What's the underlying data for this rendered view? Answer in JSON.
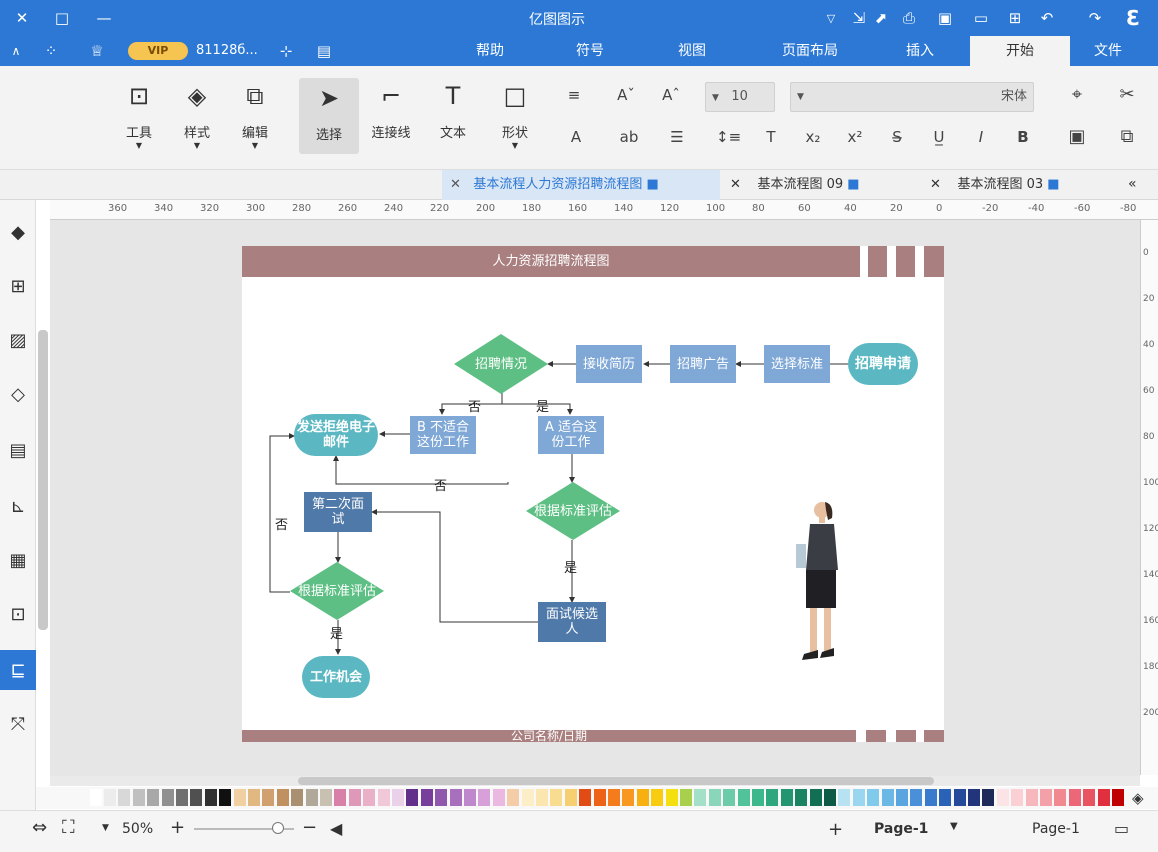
{
  "window": {
    "title": "亿图图示",
    "controls": {
      "close": "✕",
      "maximize": "□",
      "minimize": "—"
    },
    "account_id": "81128б...",
    "vip": "VIP"
  },
  "menu": {
    "tabs": [
      "文件",
      "开始",
      "插入",
      "页面布局",
      "视图",
      "符号",
      "帮助"
    ],
    "active_tab": "开始"
  },
  "ribbon": {
    "tools": [
      {
        "label": "工具",
        "icon": "tools-icon"
      },
      {
        "label": "样式",
        "icon": "paint-bucket-icon"
      },
      {
        "label": "编辑",
        "icon": "edit-frame-icon"
      },
      {
        "label": "选择",
        "icon": "select-arrow-icon"
      },
      {
        "label": "连接线",
        "icon": "connector-icon"
      },
      {
        "label": "文本",
        "icon": "text-icon"
      },
      {
        "label": "形状",
        "icon": "shape-icon"
      }
    ],
    "font_name": "宋体",
    "font_size": "10"
  },
  "doc_tabs": [
    {
      "title": "基本流程图 03"
    },
    {
      "title": "基本流程图 09"
    },
    {
      "title": "基本流程人力资源招聘流程图"
    }
  ],
  "ruler": {
    "h_labels": [
      "-80",
      "-60",
      "-40",
      "-20",
      "0",
      "20",
      "40",
      "60",
      "80",
      "100",
      "120",
      "140",
      "160",
      "180",
      "200",
      "220",
      "240",
      "260",
      "280",
      "300",
      "320",
      "340",
      "360"
    ],
    "v_labels": [
      "0",
      "20",
      "40",
      "60",
      "80",
      "100",
      "120",
      "140",
      "160",
      "180",
      "200"
    ]
  },
  "diagram": {
    "title": "人力资源招聘流程图",
    "footer": "公司名称/日期",
    "nodes": {
      "apply": "招聘申请",
      "criteria": "选择标准",
      "ad": "招聘广告",
      "resume": "接收简历",
      "status": "招聘情况",
      "fitA": "A 适合这份工作",
      "notfitB": "B 不适合这份工作",
      "reject": "发送拒绝电子邮件",
      "eval1": "根据标准评估",
      "interview2": "第二次面试",
      "candidate": "面试候选人",
      "eval2": "根据标准评估",
      "offer": "工作机会"
    },
    "edge_labels": {
      "yes1": "是",
      "no1": "否",
      "no2": "否",
      "yes2": "是",
      "no3": "否",
      "yes3": "是"
    }
  },
  "status": {
    "page_selector": "Page-1",
    "page_tab": "Page-1",
    "add": "+",
    "zoom": "50%"
  },
  "colors": {
    "accent": "#2c78d4",
    "title_band": "#a97f7f",
    "teal": "#5bb8c2",
    "light_blue": "#7fa8d6",
    "green": "#5dbf83",
    "dark_blue": "#4f79a8"
  }
}
